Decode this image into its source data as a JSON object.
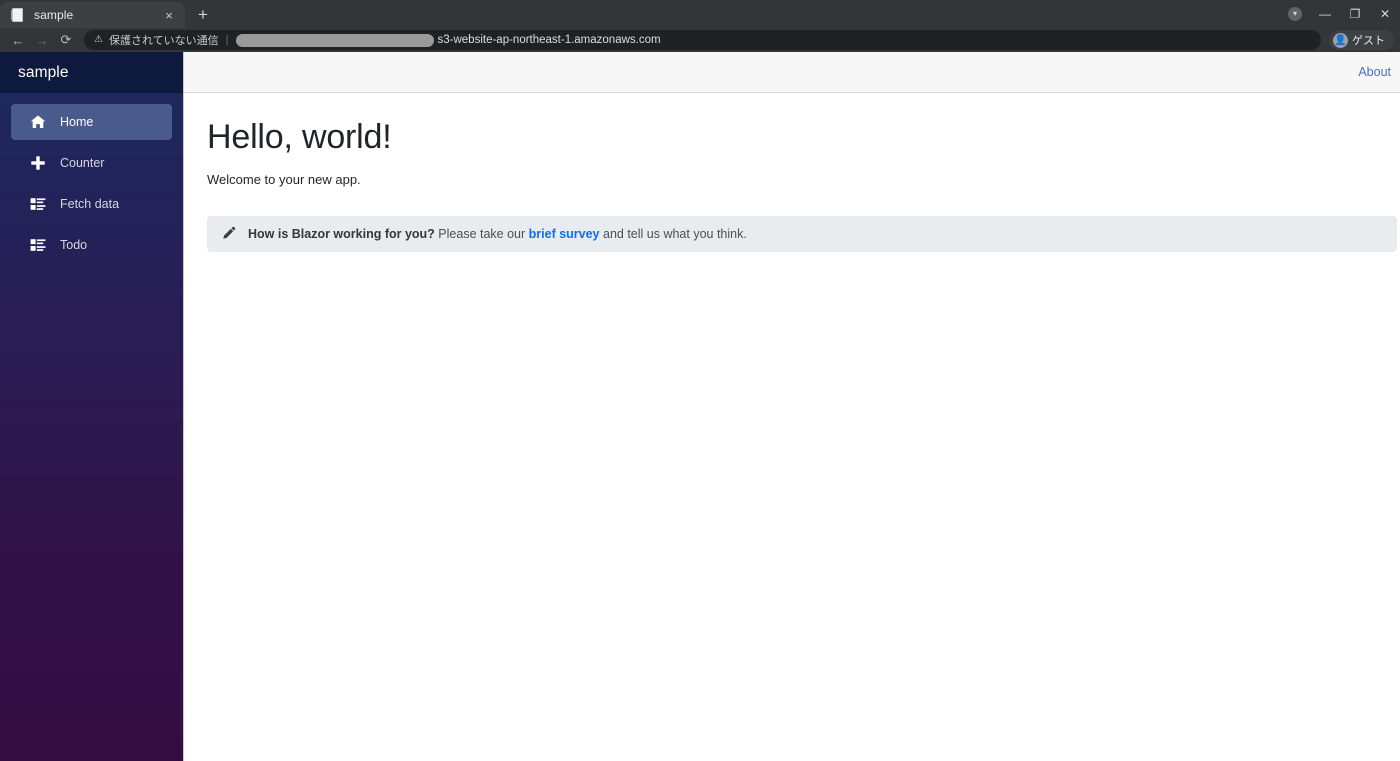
{
  "browser": {
    "tab": {
      "title": "sample",
      "favicon_icon": "page-icon",
      "close_icon": "×"
    },
    "newtab_label": "+",
    "window_controls": {
      "extension_icon": "▾",
      "minimize_label": "—",
      "maximize_label": "❐",
      "close_label": "✕"
    },
    "toolbar": {
      "back_label": "←",
      "forward_label": "→",
      "reload_label": "⟳",
      "security_icon": "⚠",
      "security_text": "保護されていない通信",
      "separator": "|",
      "url_redacted": "",
      "url_visible": "s3-website-ap-northeast-1.amazonaws.com",
      "profile_name": "ゲスト",
      "profile_icon": "person-icon"
    }
  },
  "sidebar": {
    "brand": "sample",
    "items": [
      {
        "label": "Home",
        "icon": "home-icon",
        "active": true
      },
      {
        "label": "Counter",
        "icon": "plus-icon",
        "active": false
      },
      {
        "label": "Fetch data",
        "icon": "list-rich-icon",
        "active": false
      },
      {
        "label": "Todo",
        "icon": "list-rich-icon",
        "active": false
      }
    ]
  },
  "topbar": {
    "about_label": "About"
  },
  "main": {
    "title": "Hello, world!",
    "lede": "Welcome to your new app.",
    "alert": {
      "icon": "pencil-icon",
      "strong": "How is Blazor working for you?",
      "text_before_link": " Please take our ",
      "link_label": "brief survey",
      "text_after_link": " and tell us what you think."
    }
  },
  "colors": {
    "sidebar_top": "#1b2a5e",
    "sidebar_bottom": "#340c42",
    "brand_bar": "#0d1a3d",
    "active_nav": "#4a5a8c",
    "link_blue": "#0d6efd",
    "about_blue": "#4a6fd4",
    "alert_bg": "#e9ecef",
    "topbar_bg": "#f7f7f7"
  }
}
